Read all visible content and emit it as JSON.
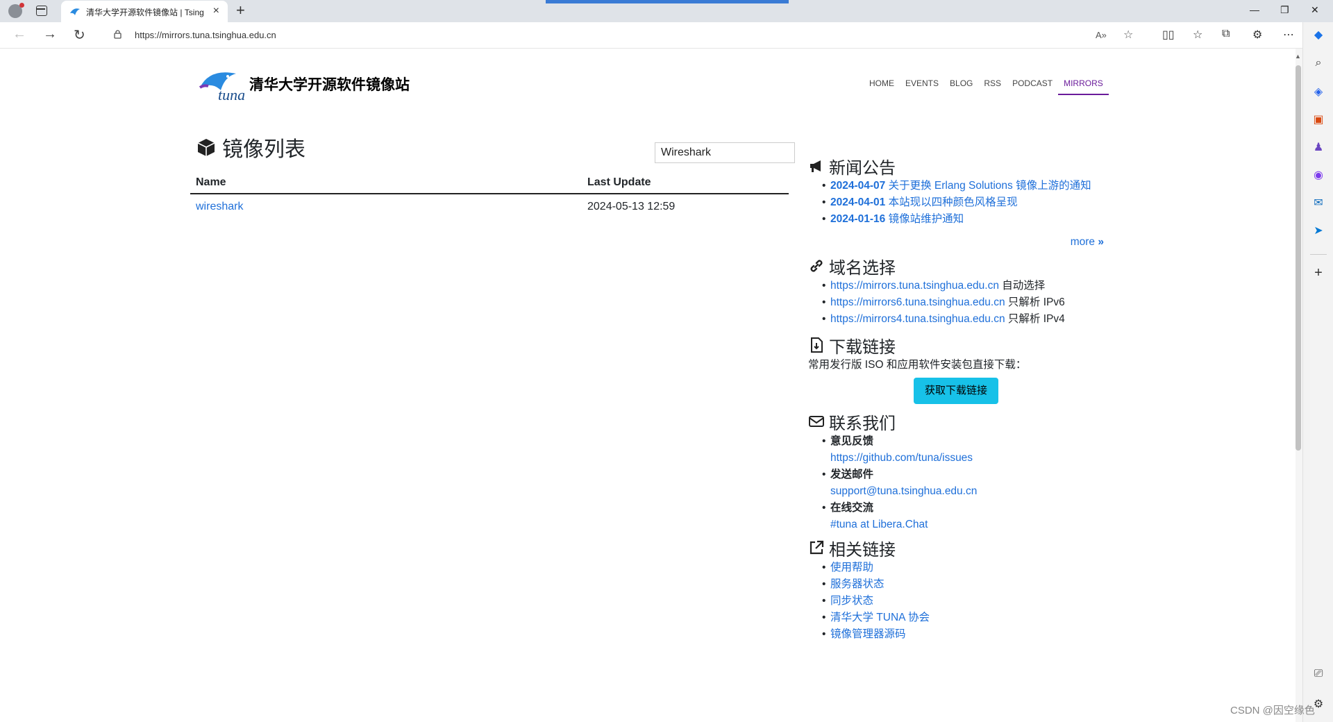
{
  "browser": {
    "tab_title": "清华大学开源软件镜像站 | Tsingh",
    "url": "https://mirrors.tuna.tsinghua.edu.cn"
  },
  "site": {
    "name": "清华大学开源软件镜像站",
    "nav": [
      "HOME",
      "EVENTS",
      "BLOG",
      "RSS",
      "PODCAST",
      "MIRRORS"
    ],
    "active_nav": "MIRRORS"
  },
  "mirrors": {
    "heading": "镜像列表",
    "filter_value": "Wireshark",
    "columns": [
      "Name",
      "Last Update"
    ],
    "rows": [
      {
        "name": "wireshark",
        "updated": "2024-05-13 12:59"
      }
    ]
  },
  "news": {
    "heading": "新闻公告",
    "items": [
      {
        "date": "2024-04-07",
        "title": "关于更换 Erlang Solutions 镜像上游的通知"
      },
      {
        "date": "2024-04-01",
        "title": "本站现以四种颜色风格呈现"
      },
      {
        "date": "2024-01-16",
        "title": "镜像站维护通知"
      }
    ],
    "more": "more"
  },
  "domains": {
    "heading": "域名选择",
    "items": [
      {
        "url": "https://mirrors.tuna.tsinghua.edu.cn",
        "desc": "自动选择"
      },
      {
        "url": "https://mirrors6.tuna.tsinghua.edu.cn",
        "desc": "只解析 IPv6"
      },
      {
        "url": "https://mirrors4.tuna.tsinghua.edu.cn",
        "desc": "只解析 IPv4"
      }
    ]
  },
  "downloads": {
    "heading": "下载链接",
    "text": "常用发行版 ISO 和应用软件安装包直接下载：",
    "button": "获取下载链接"
  },
  "contact": {
    "heading": "联系我们",
    "items": [
      {
        "label": "意见反馈",
        "link": "https://github.com/tuna/issues"
      },
      {
        "label": "发送邮件",
        "link": "support@tuna.tsinghua.edu.cn"
      },
      {
        "label": "在线交流",
        "link": "#tuna at Libera.Chat"
      }
    ]
  },
  "related": {
    "heading": "相关链接",
    "items": [
      "使用帮助",
      "服务器状态",
      "同步状态",
      "清华大学 TUNA 协会",
      "镜像管理器源码"
    ]
  },
  "watermark": "CSDN @因空缘色",
  "colors": {
    "link": "#1e6fd9",
    "active_nav": "#6a1b9a",
    "button": "#17c1e8"
  }
}
